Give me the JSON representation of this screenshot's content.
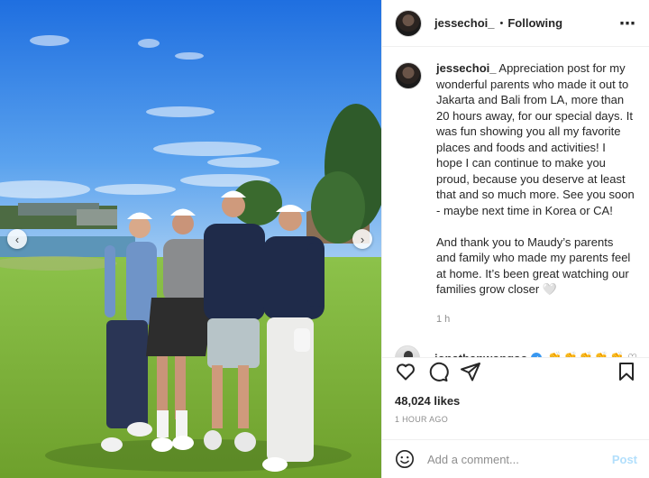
{
  "post": {
    "username": "jessechoi_",
    "separator": "•",
    "follow_status": "Following",
    "more_icon": "more-horizontal-icon",
    "caption": "Appreciation post for my wonderful parents who made it out to Jakarta and Bali from LA, more than 20 hours away, for our special days. It was fun showing you all my favorite places and foods and activities! I hope I can continue to make you proud, because you deserve at least that and so much more. See you soon - maybe next time in Korea or CA!\n\nAnd thank you to Maudy’s parents and family who made my parents feel at home. It’s been great watching our families grow closer 🤍",
    "caption_time": "1 h"
  },
  "comment": {
    "username": "jonathanwongso",
    "verified_icon": "verified-badge-icon",
    "text": "👏👏👏👏👏"
  },
  "actions": {
    "like_icon": "heart-icon",
    "comment_icon": "comment-icon",
    "share_icon": "share-icon",
    "save_icon": "bookmark-icon",
    "likes_count": "48,024 likes",
    "time": "1 HOUR AGO"
  },
  "composer": {
    "placeholder": "Add a comment...",
    "post_label": "Post",
    "post_color": "#b2dffc"
  },
  "carousel": {
    "prev_glyph": "‹",
    "next_glyph": "›"
  },
  "colors": {
    "sky": "#2f7fe0",
    "grass": "#7fb23c",
    "link_blue": "#3897f0"
  }
}
